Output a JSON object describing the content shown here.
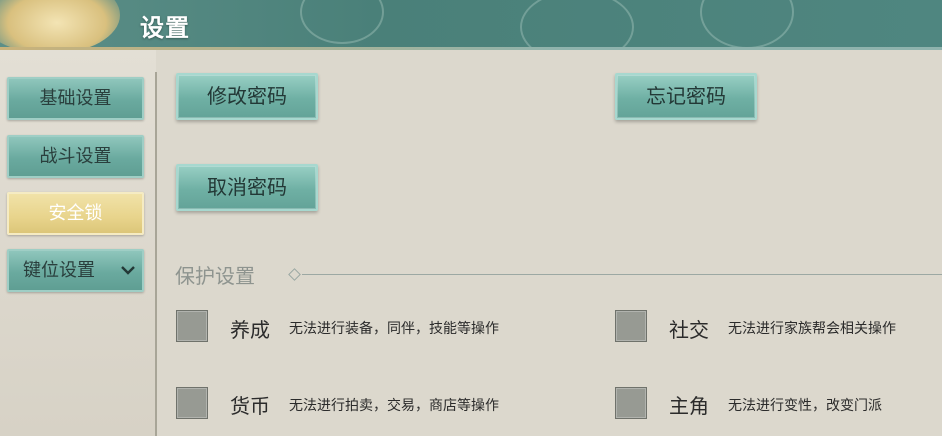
{
  "header": {
    "title": "设置"
  },
  "sidebar": {
    "tabs": [
      {
        "label": "基础设置"
      },
      {
        "label": "战斗设置"
      },
      {
        "label": "安全锁"
      },
      {
        "label": "键位设置"
      }
    ]
  },
  "buttons": {
    "change_password": "修改密码",
    "forgot_password": "忘记密码",
    "cancel_password": "取消密码"
  },
  "protection": {
    "title": "保护设置",
    "options": [
      {
        "name": "养成",
        "desc": "无法进行装备，同伴，技能等操作"
      },
      {
        "name": "社交",
        "desc": "无法进行家族帮会相关操作"
      },
      {
        "name": "货币",
        "desc": "无法进行拍卖，交易，商店等操作"
      },
      {
        "name": "主角",
        "desc": "无法进行变性，改变门派"
      }
    ]
  },
  "colors": {
    "header_teal": "#4a8079",
    "tab_teal": "#6aaa9f",
    "tab_active_gold": "#e8d48c",
    "background": "#dcd8cd"
  }
}
